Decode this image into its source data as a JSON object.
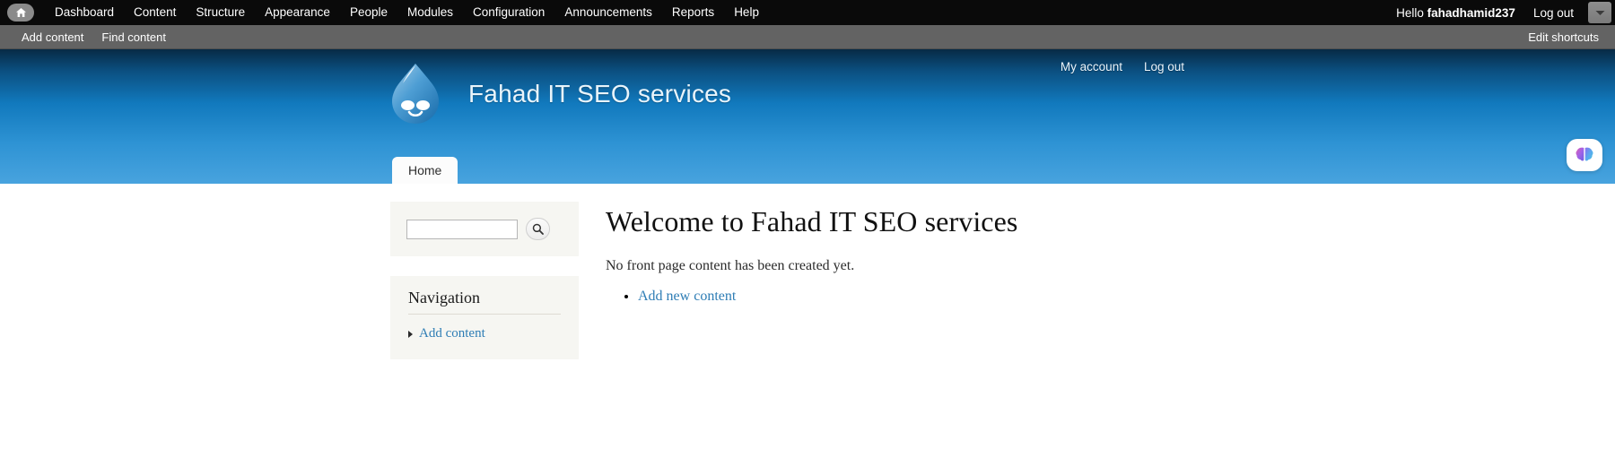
{
  "toolbar": {
    "home_icon": "home-icon",
    "menu": [
      {
        "label": "Dashboard"
      },
      {
        "label": "Content"
      },
      {
        "label": "Structure"
      },
      {
        "label": "Appearance"
      },
      {
        "label": "People"
      },
      {
        "label": "Modules"
      },
      {
        "label": "Configuration"
      },
      {
        "label": "Announcements"
      },
      {
        "label": "Reports"
      },
      {
        "label": "Help"
      }
    ],
    "greeting_prefix": "Hello ",
    "username": "fahadhamid237",
    "logout_label": "Log out",
    "toggle_icon": "chevron-down-icon",
    "background": "#0a0a0a"
  },
  "shortcuts": {
    "items": [
      {
        "label": "Add content"
      },
      {
        "label": "Find content"
      }
    ],
    "edit_label": "Edit shortcuts",
    "background": "#636363"
  },
  "site_header": {
    "logo_icon": "drupal-droplet-logo",
    "site_name": "Fahad IT SEO services",
    "user_links": [
      {
        "label": "My account"
      },
      {
        "label": "Log out"
      }
    ],
    "tabs": [
      {
        "label": "Home"
      }
    ],
    "gradient_top": "#072a45",
    "gradient_bottom": "#48a3de"
  },
  "sidebar": {
    "search": {
      "value": "",
      "placeholder": "",
      "submit_icon": "search-icon"
    },
    "navigation": {
      "title": "Navigation",
      "items": [
        {
          "label": "Add content",
          "bullet": "triangle-right-bullet"
        }
      ]
    }
  },
  "main": {
    "title": "Welcome to Fahad IT SEO services",
    "empty_message": "No front page content has been created yet.",
    "actions": [
      {
        "label": "Add new content"
      }
    ],
    "link_color": "#2e7db5"
  },
  "assistant": {
    "icon": "brain-icon"
  }
}
